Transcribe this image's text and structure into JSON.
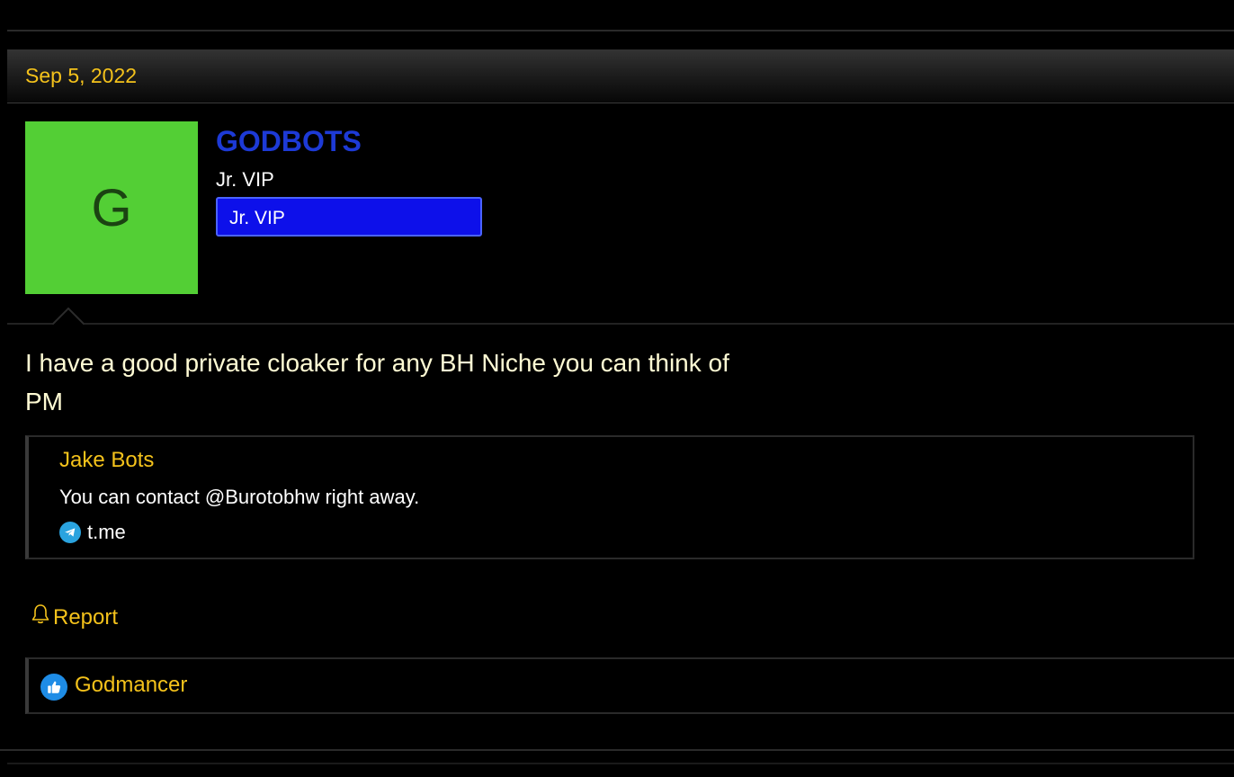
{
  "post": {
    "date": "Sep 5, 2022"
  },
  "user": {
    "avatar_letter": "G",
    "avatar_color": "#53cf35",
    "username": "GODBOTS",
    "username_color": "#1d3ad6",
    "title": "Jr. VIP",
    "banner": "Jr. VIP",
    "banner_color": "#0d10ea"
  },
  "message": {
    "lines": [
      "I have a good private cloaker for any BH Niche you can think of",
      "PM"
    ]
  },
  "quote": {
    "author": "Jake Bots",
    "text": "You can contact @Burotobhw right away.",
    "link_label": "t.me",
    "link_icon": "telegram-icon"
  },
  "actions": {
    "report_label": "Report",
    "report_icon": "bell-icon"
  },
  "reactions": {
    "icon": "thumbs-up-icon",
    "users": "Godmancer"
  },
  "colors": {
    "accent": "#f4c21b",
    "background": "#000000"
  }
}
